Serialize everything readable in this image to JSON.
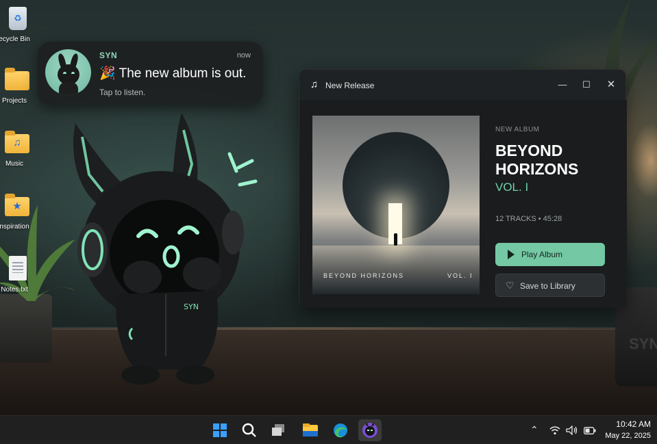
{
  "desktop": {
    "icons": [
      {
        "label": "ecycle Bin",
        "icon": "recycle-bin-icon"
      },
      {
        "label": "Projects",
        "icon": "folder-icon"
      },
      {
        "label": "Music",
        "icon": "music-folder-icon"
      },
      {
        "label": "nspiration",
        "icon": "star-folder-icon"
      },
      {
        "label": "Notes.txt",
        "icon": "text-file-icon"
      }
    ]
  },
  "notification": {
    "app": "SYN",
    "time": "now",
    "message": "🎉 The new album is out.",
    "subtext": "Tap to listen."
  },
  "mascot": {
    "hoodie_text": "SYN",
    "accent_color": "#7fe3b6"
  },
  "album_window": {
    "title": "New Release",
    "label": "NEW ALBUM",
    "album_title_line1": "BEYOND",
    "album_title_line2": "HORIZONS",
    "volume": "VOL. I",
    "meta": "12 TRACKS • 45:28",
    "cover_text_left": "BEYOND HORIZONS",
    "cover_text_right": "VOL. I",
    "play_label": "Play Album",
    "save_label": "Save to Library",
    "accent_color": "#74c8a4"
  },
  "taskbar": {
    "apps": [
      "start-icon",
      "search-icon",
      "task-view-icon",
      "file-explorer-icon",
      "edge-icon",
      "syn-app-icon"
    ],
    "active_app": "syn-app-icon",
    "clock_time": "10:42 AM",
    "clock_date": "May 22, 2025"
  }
}
